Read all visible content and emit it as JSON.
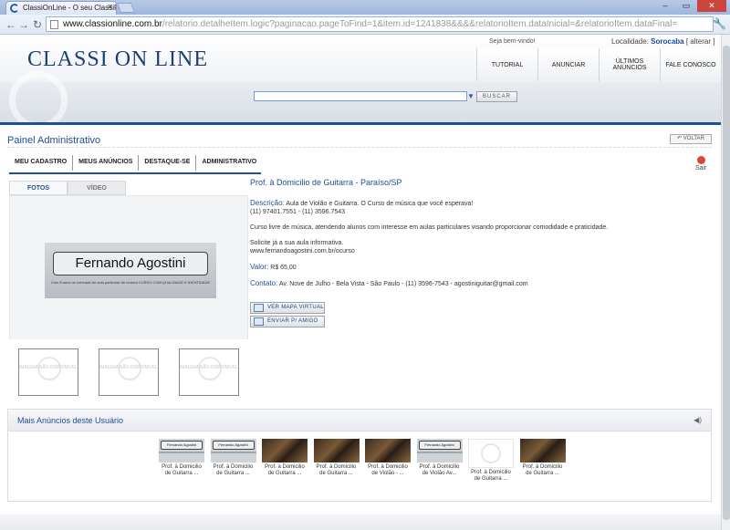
{
  "browser": {
    "tab_title": "ClassiOnLine - O seu ClassiFi",
    "url_host": "www.classionline.com.br",
    "url_path": "/relatorio.detalheItem.logic?paginacao.pageToFind=1&item.id=1241838&&&&relatorioItem.dataInicial=&relatorioItem.dataFinal=",
    "window_buttons": [
      "–",
      "▭",
      "✕"
    ]
  },
  "site": {
    "logo": "CLASSI ON LINE",
    "welcome": "Seja bem-vindo!",
    "locality_label": "Localidade:",
    "locality_value": "Sorocaba",
    "locality_change": "[ alterar ]",
    "nav": [
      "TUTORIAL",
      "ANUNCIAR",
      "ÚLTIMOS ANÚNCIOS",
      "FALE CONOSCO"
    ],
    "search_button": "BUSCAR"
  },
  "panel": {
    "title": "Painel Administrativo",
    "back": "VOLTAR",
    "tabs": [
      "MEU CADASTRO",
      "MEUS ANÚNCIOS",
      "DESTAQUE-SE",
      "ADMINISTRATIVO"
    ],
    "exit": "Sair"
  },
  "media": {
    "tabs": [
      "FOTOS",
      "VÍDEO"
    ],
    "photo_name": "Fernando Agostini",
    "photo_sub": "Com 8 anos no mercado de aula particular de música CURSO COM QUALIDADE E IDENTIDADE",
    "no_image": "IMAGEM NÃO DISPONÍVEL"
  },
  "ad": {
    "title": "Prof. à Domicilio de Guitarra - Paraíso/SP",
    "description_label": "Descrição:",
    "description": "Aula de Violão e Guitarra. O Curso de música que você esperava!",
    "phones": "(11) 97401.7551 - (11) 3596.7543",
    "paragraph": "Curso livre de música, atendendo alunos com interesse em aulas particulares visando proporcionar comodidade e praticidade.",
    "cta": "Solicite já a sua aula informativa.",
    "website": "www.fernandoagostini.com.br/ocurso",
    "value_label": "Valor:",
    "value": "R$ 65,00",
    "contact_label": "Contato:",
    "contact": "Av. Nove de Julho - Bela Vista - São Paulo - (11) 3596-7543 - agostiniguitar@gmail.com",
    "btn_map": "VER MAPA VIRTUAL",
    "btn_send": "ENVIAR P/ AMIGO"
  },
  "more": {
    "title": "Mais Anúncios deste Usuário",
    "items": [
      {
        "label": "Prof. à Domicilio de Guitarra ...",
        "img": "fa",
        "img_text": "Fernando Agostini"
      },
      {
        "label": "Prof. à Domicilio de Guitarra ...",
        "img": "fa",
        "img_text": "Fernando Agostini"
      },
      {
        "label": "Prof. à Domicilio de Guitarra ...",
        "img": "guitar",
        "img_text": ""
      },
      {
        "label": "Prof. à Domicilio de Guitarra ...",
        "img": "guitar",
        "img_text": ""
      },
      {
        "label": "Prof. à Domicilio de Violão - ...",
        "img": "guitar",
        "img_text": ""
      },
      {
        "label": "Prof. à Domicilio de Violão Av...",
        "img": "fa",
        "img_text": "Fernando Agostini"
      },
      {
        "label": "Prof. à Domicilio de Guitarra ...",
        "img": "none",
        "img_text": ""
      },
      {
        "label": "Prof. à Domicilio de Guitarra ...",
        "img": "guitar",
        "img_text": ""
      }
    ]
  }
}
